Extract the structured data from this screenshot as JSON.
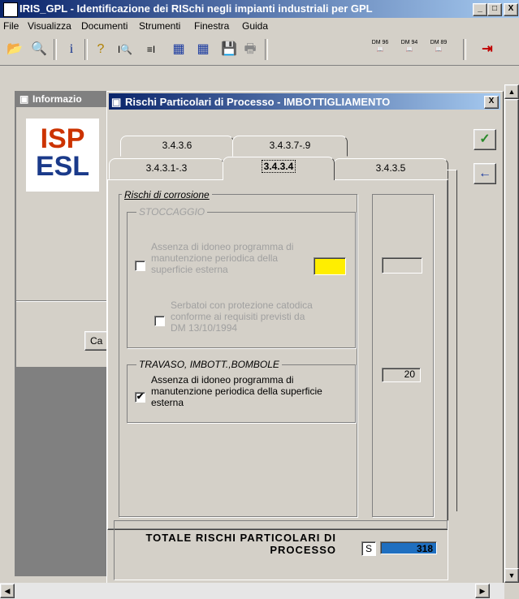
{
  "app": {
    "title": "IRIS_GPL - Identificazione dei RISchi negli impianti industriali  per GPL",
    "controls": {
      "minimize": "_",
      "maximize": "□",
      "close": "X"
    }
  },
  "menu": [
    "File",
    "Visualizza",
    "Documenti",
    "Strumenti",
    "Finestra",
    "Guida"
  ],
  "toolbar": {
    "icons": [
      "open-folder-icon",
      "search-icon",
      "info-icon",
      "help-icon",
      "zoom-doc-icon",
      "insert-icon",
      "table-search-icon",
      "table-icon",
      "save-icon",
      "print-icon"
    ],
    "glyphs": [
      "📂",
      "🔍",
      "i",
      "?",
      "I🔍",
      "≡I",
      "▦",
      "▦",
      "💾",
      "🖶"
    ],
    "dm": [
      "DM 96",
      "DM 94",
      "DM 89"
    ],
    "exit_glyph": "⇥"
  },
  "back_window": {
    "title": "Informazio",
    "logo": [
      "ISP",
      "ESL"
    ],
    "button_label": "Ca"
  },
  "dialog": {
    "title": "Rischi Particolari di Processo - IMBOTTIGLIAMENTO",
    "close": "X",
    "tabs_row1": [
      "3.4.3.6",
      "3.4.3.7-.9"
    ],
    "tabs_row2": [
      "3.4.3.1-.3",
      "3.4.3.4",
      "3.4.3.5"
    ],
    "active_tab": "3.4.3.4",
    "outer_group": "Rischi di corrosione",
    "group_stoccaggio": {
      "title": "STOCCAGGIO",
      "item1": "Assenza di idoneo programma di manutenzione periodica della superficie esterna",
      "item2": "Serbatoi con protezione catodica conforme ai requisiti previsti da DM 13/10/1994",
      "value": ""
    },
    "group_travaso": {
      "title": "TRAVASO, IMBOTT.,BOMBOLE",
      "item1": "Assenza di idoneo programma di manutenzione periodica della superficie esterna",
      "checked": "✔",
      "value": "20"
    },
    "ok_glyph": "✓",
    "back_glyph": "←",
    "total": {
      "label": "TOTALE RISCHI PARTICOLARI DI PROCESSO",
      "unit": "S",
      "value": "318"
    }
  },
  "colors": {
    "title_start": "#0a246a",
    "title_end": "#a6caf0",
    "highlight": "#ffee00",
    "value_bg": "#1f6fc0"
  }
}
